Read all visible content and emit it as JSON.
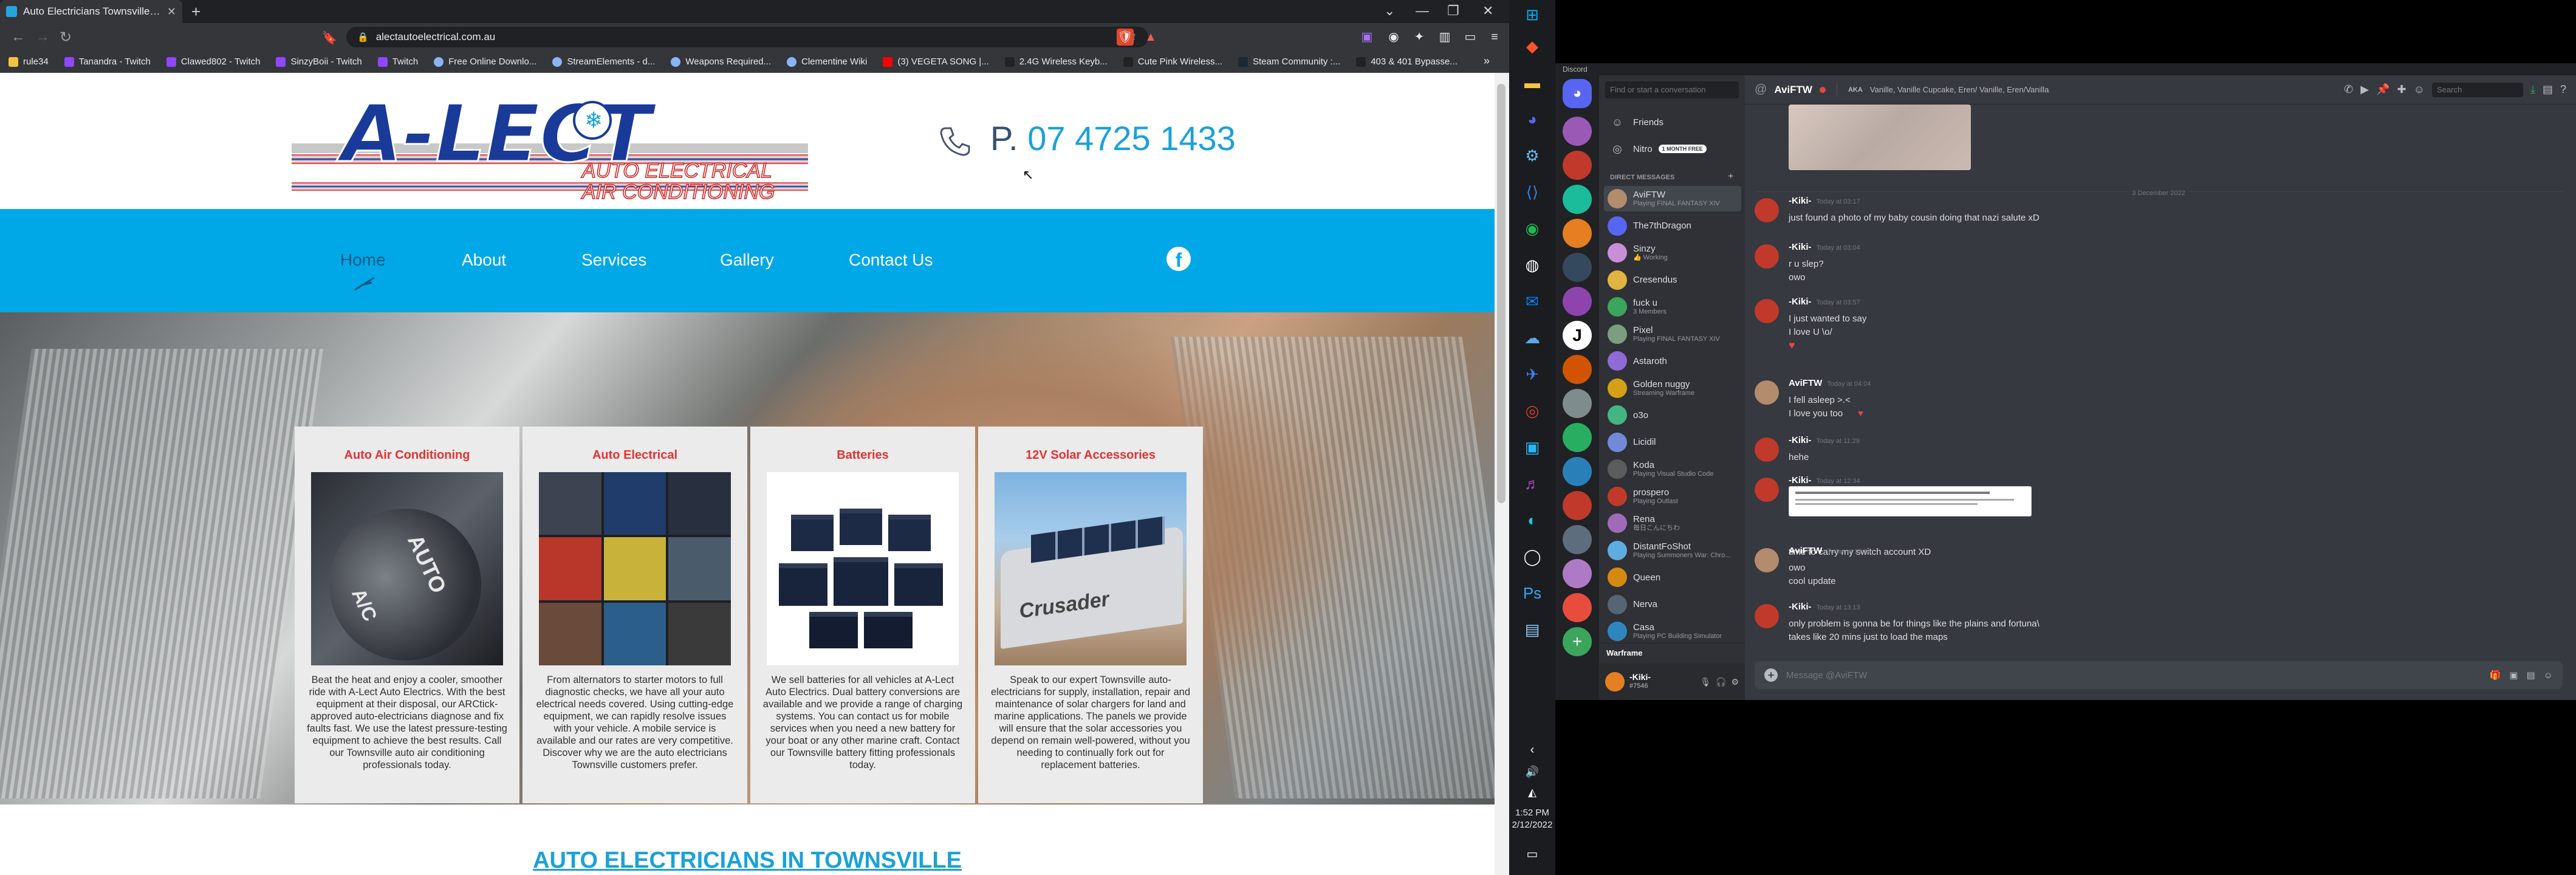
{
  "browser": {
    "tab_title": "Auto Electricians Townsville | A-Lect",
    "url": "alectautoelectrical.com.au",
    "bookmarks": [
      "rule34",
      "Tanandra - Twitch",
      "Clawed802 - Twitch",
      "SinzyBoii - Twitch",
      "Twitch",
      "Free Online Downlo...",
      "StreamElements - d...",
      "Weapons Required...",
      "Clementine Wiki",
      "(3) VEGETA SONG |...",
      "2.4G Wireless Keyb...",
      "Cute Pink Wireless...",
      "Steam Community :...",
      "403 & 401 Bypasse..."
    ]
  },
  "site": {
    "logo_main": "A-LECT",
    "logo_line1": "AUTO ELECTRICAL",
    "logo_line2": "AIR CONDITIONING",
    "phone_prefix": "P.",
    "phone_number": "07 4725 1433",
    "nav": [
      "Home",
      "About",
      "Services",
      "Gallery",
      "Contact Us"
    ],
    "social": "f",
    "cards": [
      {
        "title": "Auto Air Conditioning",
        "text": "Beat the heat and enjoy a cooler, smoother ride with A-Lect Auto Electrics. With the best equipment at their disposal, our ARCtick-approved auto-electricians diagnose and fix faults fast. We use the latest pressure-testing equipment to achieve the best results. Call our Townsville auto air conditioning professionals today."
      },
      {
        "title": "Auto Electrical",
        "text": "From alternators to starter motors to full diagnostic checks, we have all your auto electrical needs covered. Using cutting-edge equipment, we can rapidly resolve issues with your vehicle. A mobile service is available and our rates are very competitive. Discover why we are the auto electricians Townsville customers prefer."
      },
      {
        "title": "Batteries",
        "text": "We sell batteries for all vehicles at A-Lect Auto Electrics. Dual battery conversions are available and we provide a range of charging systems. You can contact us for mobile services when you need a new battery for your boat or any other marine craft. Contact our Townsville battery fitting professionals today."
      },
      {
        "title": "12V Solar Accessories",
        "text": "Speak to our expert Townsville auto-electricians for supply, installation, repair and maintenance of solar chargers for land and marine applications. The panels we provide will ensure that the solar accessories you depend on remain well-powered, without you needing to continually fork out for replacement batteries."
      }
    ],
    "card_images": {
      "ac_text1": "AUTO",
      "ac_text2": "A/C",
      "solar_text": "Crusader"
    },
    "seo_heading": "AUTO ELECTRICIANS IN TOWNSVILLE"
  },
  "taskbar": {
    "time": "1:52 PM",
    "date": "2/12/2022"
  },
  "discord": {
    "app_title": "Discord",
    "search_placeholder": "Find or start a conversation",
    "friends": "Friends",
    "nitro": "Nitro",
    "nitro_badge": "1 MONTH FREE",
    "dm_header": "DIRECT MESSAGES",
    "dms": [
      {
        "name": "AviFTW",
        "status": "Playing FINAL FANTASY XIV",
        "color": "#b38b6d"
      },
      {
        "name": "The7thDragon",
        "status": "",
        "color": "#5865f2"
      },
      {
        "name": "Sinzy",
        "status": "👍 Working",
        "color": "#c98fd6"
      },
      {
        "name": "Cresendus",
        "status": "",
        "color": "#e3b341"
      },
      {
        "name": "fuck u",
        "status": "3 Members",
        "color": "#3ba55c"
      },
      {
        "name": "Pixel",
        "status": "Playing FINAL FANTASY XIV",
        "color": "#7a9e7e"
      },
      {
        "name": "Astaroth",
        "status": "",
        "color": "#8e6bd6"
      },
      {
        "name": "Golden nuggy",
        "status": "Streaming Warframe",
        "color": "#d4a017"
      },
      {
        "name": "o3o",
        "status": "",
        "color": "#43b581"
      },
      {
        "name": "Licidil",
        "status": "",
        "color": "#7289da"
      },
      {
        "name": "Koda",
        "status": "Playing Visual Studio Code",
        "color": "#5c5c5c"
      },
      {
        "name": "prospero",
        "status": "Playing Outlast",
        "color": "#c0392b"
      },
      {
        "name": "Rena",
        "status": "毎日こんにちわ",
        "color": "#a16ab8"
      },
      {
        "name": "DistantFoShot",
        "status": "Playing Summoners War: Chro...",
        "color": "#5dade2"
      },
      {
        "name": "Queen",
        "status": "",
        "color": "#d68910"
      },
      {
        "name": "Nerva",
        "status": "",
        "color": "#566573"
      },
      {
        "name": "Casa",
        "status": "Playing PC Building Simulator",
        "color": "#2e86c1"
      }
    ],
    "voice_bar": "Warframe",
    "me_name": "-Kiki-",
    "me_tag": "#7546",
    "channel_name": "AviFTW",
    "aka_label": "AKA",
    "aka_names": "Vanille, Vanille Cupcake, Eren/ Vanille, Eren/Vanilla",
    "header_search": "Search",
    "date_divider": "3 December 2022",
    "messages": [
      {
        "user": "-Kiki-",
        "time": "Today at 03:17",
        "lines": [
          "just found a photo of my baby cousin doing that nazi salute xD"
        ]
      },
      {
        "user": "-Kiki-",
        "time": "Today at 03:04",
        "lines": [
          "r u slep?",
          "owo"
        ]
      },
      {
        "user": "-Kiki-",
        "time": "Today at 03:57",
        "lines": [
          "I just wanted to say",
          "I love U \\o/"
        ]
      },
      {
        "user": "AviFTW",
        "time": "Today at 04:04",
        "lines": [
          "I fell asleep >.<",
          "I love you too"
        ]
      },
      {
        "user": "-Kiki-",
        "time": "Today at 11:29",
        "lines": [
          "hehe"
        ]
      },
      {
        "user": "-Kiki-",
        "time": "Today at 12:34",
        "lines": [
          "time to carry my switch account XD"
        ]
      },
      {
        "user": "AviFTW",
        "time": "Today at 13:14",
        "lines": [
          "owo",
          "cool update"
        ]
      },
      {
        "user": "-Kiki-",
        "time": "Today at 13:13",
        "lines": [
          "only problem is gonna be for things like the plains and fortuna\\",
          "takes like 20 mins just to load the maps"
        ]
      }
    ],
    "input_placeholder": "Message @AviFTW"
  }
}
